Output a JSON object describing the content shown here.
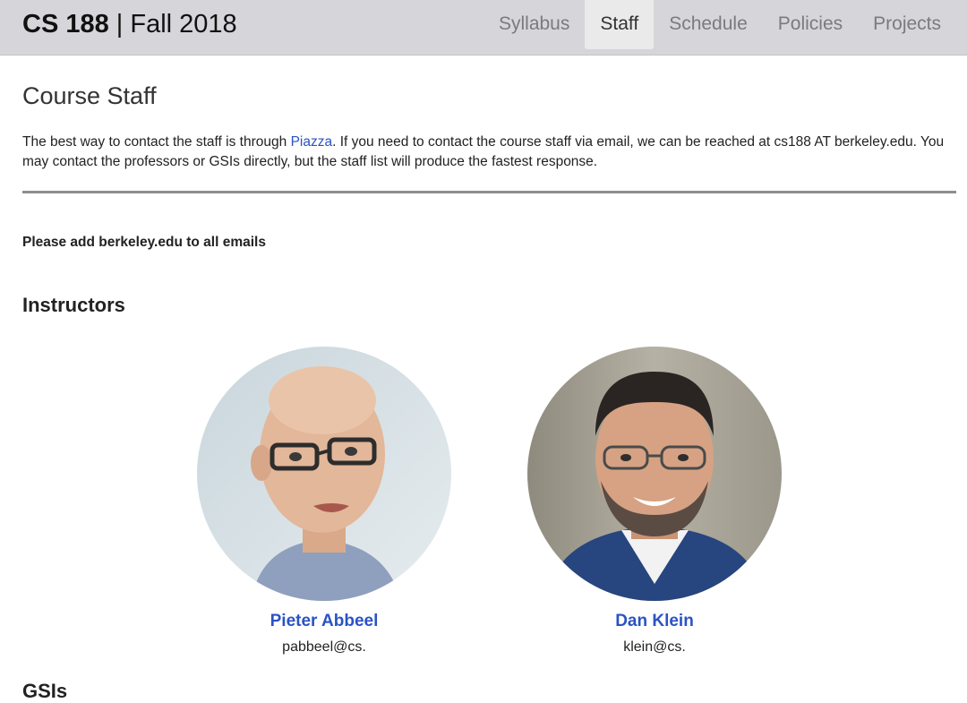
{
  "header": {
    "course_code": "CS 188",
    "separator": " | ",
    "term": "Fall 2018"
  },
  "nav": {
    "items": [
      {
        "label": "Syllabus",
        "active": false
      },
      {
        "label": "Staff",
        "active": true
      },
      {
        "label": "Schedule",
        "active": false
      },
      {
        "label": "Policies",
        "active": false
      },
      {
        "label": "Projects",
        "active": false
      }
    ]
  },
  "main": {
    "title": "Course Staff",
    "intro_before_link": "The best way to contact the staff is through ",
    "intro_link": "Piazza",
    "intro_after_link": ". If you need to contact the course staff via email, we can be reached at cs188 AT berkeley.edu. You may contact the professors or GSIs directly, but the staff list will produce the fastest response.",
    "email_note": "Please add berkeley.edu to all emails",
    "instructors_heading": "Instructors",
    "next_heading": "GSIs"
  },
  "instructors": [
    {
      "name": "Pieter Abbeel",
      "email": "pabbeel@cs."
    },
    {
      "name": "Dan Klein",
      "email": "klein@cs."
    }
  ],
  "colors": {
    "navbar_bg": "#d6d5da",
    "link": "#2a53c4",
    "divider": "#8e8e90"
  }
}
